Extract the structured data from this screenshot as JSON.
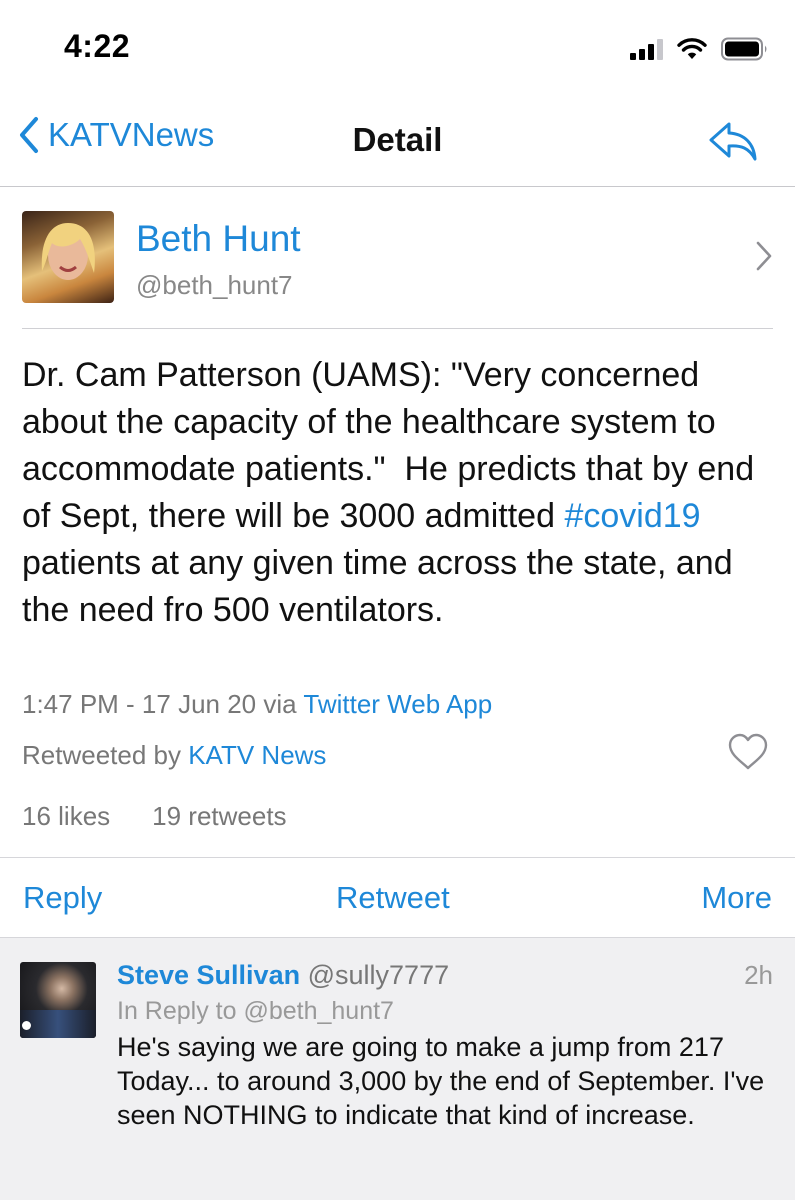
{
  "status_bar": {
    "time": "4:22"
  },
  "nav": {
    "back_label": "KATVNews",
    "title": "Detail"
  },
  "tweet": {
    "author_name": "Beth Hunt",
    "author_handle": "@beth_hunt7",
    "text_before": "Dr. Cam Patterson (UAMS): \"Very concerned about the capacity of the healthcare system to accommodate patients.\"  He predicts that by end of Sept, there will be 3000 admitted ",
    "hashtag": "#covid19",
    "text_after": " patients at any given time across the state, and the need fro 500 ventilators.",
    "timestamp": "1:47 PM - 17 Jun 20",
    "via_word": "via",
    "source": "Twitter Web App",
    "retweeted_by_label": "Retweeted by",
    "retweeted_by": "KATV News",
    "likes": "16 likes",
    "retweets": "19 retweets"
  },
  "actions": {
    "reply": "Reply",
    "retweet": "Retweet",
    "more": "More"
  },
  "reply": {
    "name": "Steve Sullivan",
    "handle": "@sully7777",
    "time": "2h",
    "in_reply_to": "In Reply to @beth_hunt7",
    "text": "He's saying we are going to make a jump from 217 Today... to around 3,000 by the end of September.   I've seen NOTHING to indicate that kind of increase."
  },
  "colors": {
    "link": "#1e88d8",
    "meta": "#777777",
    "reply_bg": "#f0f0f2"
  },
  "icons": [
    "cellular-signal-icon",
    "wifi-icon",
    "battery-icon",
    "back-chevron-icon",
    "reply-arrow-icon",
    "chevron-right-icon",
    "heart-icon"
  ]
}
